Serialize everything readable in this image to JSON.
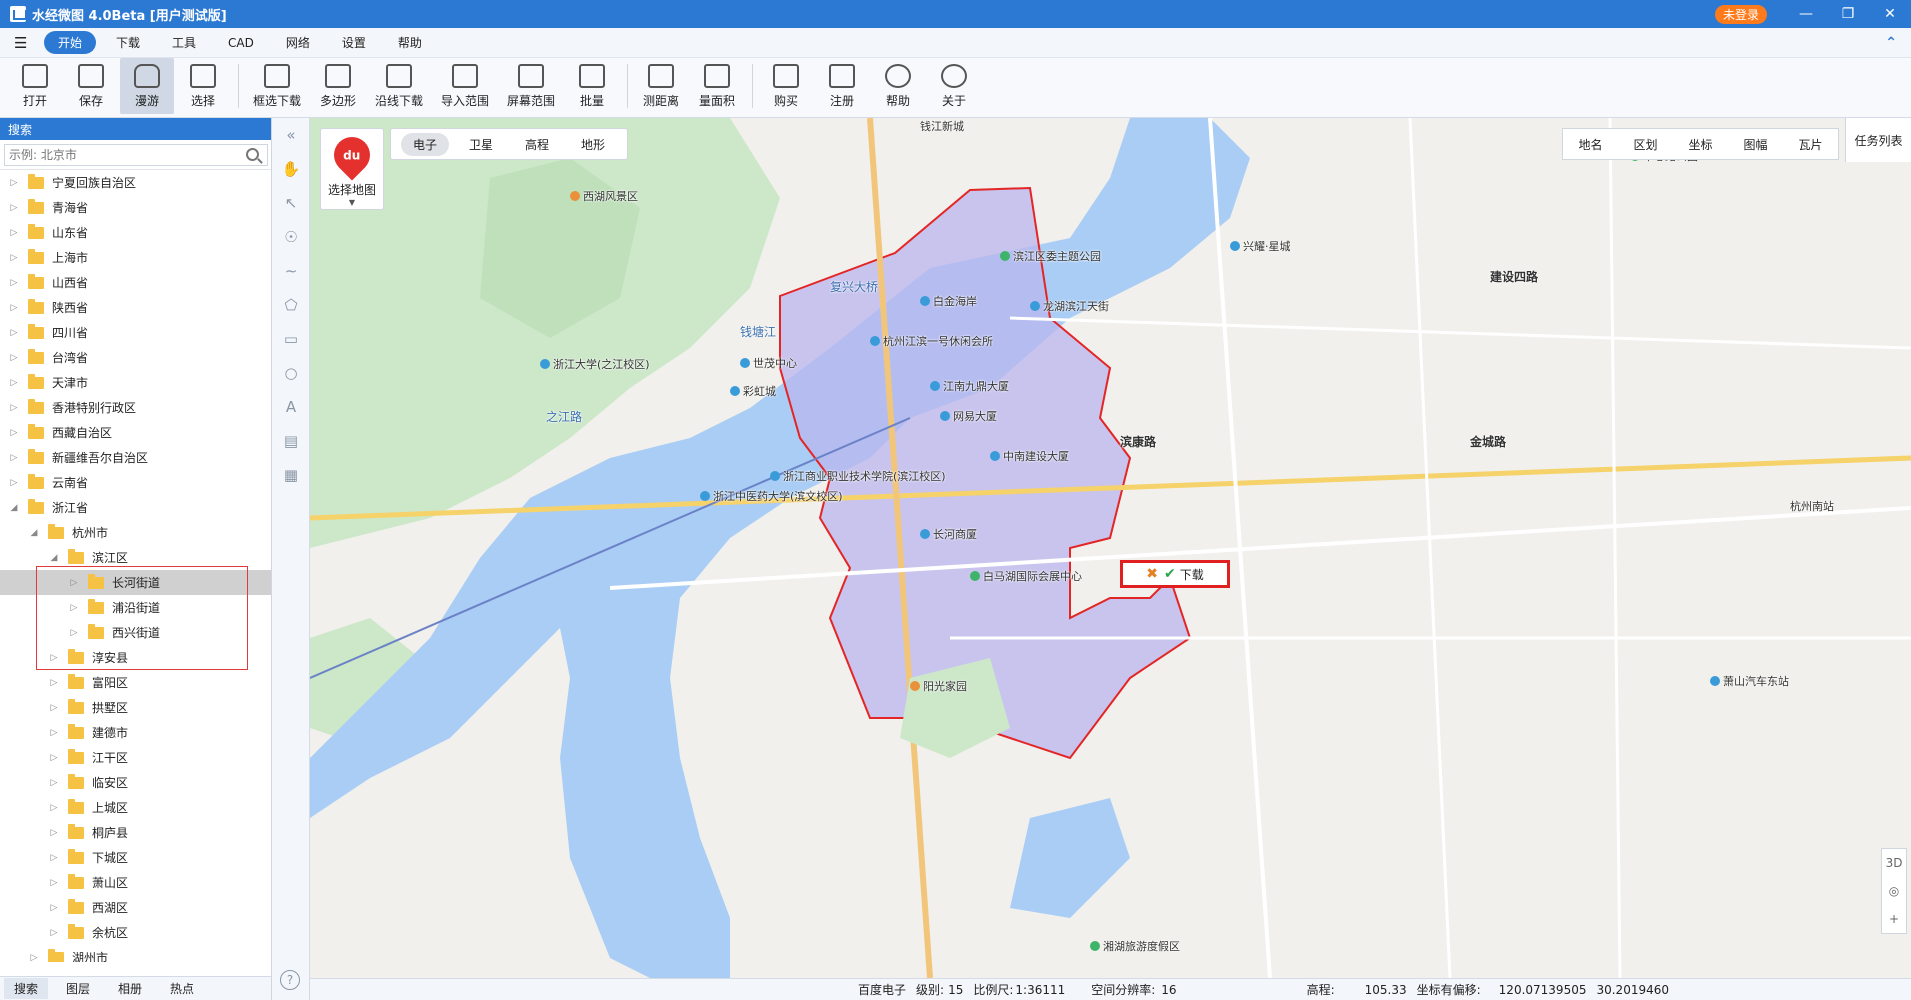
{
  "app": {
    "title": "水经微图 4.0Beta [用户测试版]",
    "login_label": "未登录"
  },
  "menu": {
    "items": [
      "开始",
      "下载",
      "工具",
      "CAD",
      "网络",
      "设置",
      "帮助"
    ]
  },
  "toolbar": {
    "open": "打开",
    "save": "保存",
    "pan": "漫游",
    "select": "选择",
    "box_download": "框选下载",
    "polygon": "多边形",
    "line_download": "沿线下载",
    "import_range": "导入范围",
    "screen_range": "屏幕范围",
    "batch": "批量",
    "measure_distance": "测距离",
    "measure_area": "量面积",
    "buy": "购买",
    "register": "注册",
    "help": "帮助",
    "about": "关于"
  },
  "left_panel": {
    "header": "搜索",
    "search_placeholder": "示例: 北京市",
    "tree": [
      {
        "label": "宁夏回族自治区",
        "level": 0
      },
      {
        "label": "青海省",
        "level": 0
      },
      {
        "label": "山东省",
        "level": 0
      },
      {
        "label": "上海市",
        "level": 0
      },
      {
        "label": "山西省",
        "level": 0
      },
      {
        "label": "陕西省",
        "level": 0
      },
      {
        "label": "四川省",
        "level": 0
      },
      {
        "label": "台湾省",
        "level": 0
      },
      {
        "label": "天津市",
        "level": 0
      },
      {
        "label": "香港特别行政区",
        "level": 0
      },
      {
        "label": "西藏自治区",
        "level": 0
      },
      {
        "label": "新疆维吾尔自治区",
        "level": 0
      },
      {
        "label": "云南省",
        "level": 0
      },
      {
        "label": "浙江省",
        "level": 0
      },
      {
        "label": "杭州市",
        "level": 1
      },
      {
        "label": "滨江区",
        "level": 2
      },
      {
        "label": "长河街道",
        "level": 3
      },
      {
        "label": "浦沿街道",
        "level": 3
      },
      {
        "label": "西兴街道",
        "level": 3
      },
      {
        "label": "淳安县",
        "level": 2
      },
      {
        "label": "富阳区",
        "level": 2
      },
      {
        "label": "拱墅区",
        "level": 2
      },
      {
        "label": "建德市",
        "level": 2
      },
      {
        "label": "江干区",
        "level": 2
      },
      {
        "label": "临安区",
        "level": 2
      },
      {
        "label": "上城区",
        "level": 2
      },
      {
        "label": "桐庐县",
        "level": 2
      },
      {
        "label": "下城区",
        "level": 2
      },
      {
        "label": "萧山区",
        "level": 2
      },
      {
        "label": "西湖区",
        "level": 2
      },
      {
        "label": "余杭区",
        "level": 2
      },
      {
        "label": "湖州市",
        "level": 1
      }
    ],
    "bottom_tabs": [
      "搜索",
      "图层",
      "相册",
      "热点"
    ]
  },
  "map": {
    "source_label": "选择地图",
    "map_types": [
      "电子",
      "卫星",
      "高程",
      "地形"
    ],
    "layer_tabs": [
      "地名",
      "区划",
      "坐标",
      "图幅",
      "瓦片"
    ],
    "task_list": "任务列表",
    "download_label": "下载",
    "zoom_controls": [
      "3D",
      "+"
    ],
    "labels": [
      {
        "text": "钱塘江",
        "type": "road"
      },
      {
        "text": "之江路",
        "type": "road"
      },
      {
        "text": "滨康路",
        "type": "bold"
      },
      {
        "text": "金城路",
        "type": "bold"
      },
      {
        "text": "建设四路",
        "type": "bold"
      },
      {
        "text": "复兴大桥",
        "type": "road"
      },
      {
        "text": "杭州南站",
        "type": "plain"
      },
      {
        "text": "钱江新城",
        "type": "plain"
      },
      {
        "text": "浙江大学(之江校区)",
        "type": "plain"
      },
      {
        "text": "杭州江滨一号休闲会所",
        "type": "plain"
      },
      {
        "text": "白马湖国际会展中心",
        "type": "plain"
      },
      {
        "text": "阳光家园",
        "type": "plain"
      },
      {
        "text": "长河商厦",
        "type": "plain"
      },
      {
        "text": "江南九鼎大厦",
        "type": "plain"
      },
      {
        "text": "网易大厦",
        "type": "plain"
      },
      {
        "text": "中南建设大厦",
        "type": "plain"
      },
      {
        "text": "龙湖滨江天街",
        "type": "plain"
      },
      {
        "text": "滨江区委主题公园",
        "type": "plain"
      },
      {
        "text": "白金海岸",
        "type": "plain"
      },
      {
        "text": "浙江商业职业技术学院(滨江校区)",
        "type": "plain"
      },
      {
        "text": "浙江中医药大学(滨文校区)",
        "type": "plain"
      },
      {
        "text": "彩虹城",
        "type": "plain"
      },
      {
        "text": "世茂中心",
        "type": "plain"
      },
      {
        "text": "西湖风景区",
        "type": "plain"
      },
      {
        "text": "湘湖旅游度假区",
        "type": "plain"
      },
      {
        "text": "萧山汽车东站",
        "type": "plain"
      },
      {
        "text": "兴耀·星城",
        "type": "plain"
      },
      {
        "text": "市心路公园",
        "type": "plain"
      }
    ]
  },
  "status": {
    "provider": "百度电子",
    "level_label": "级别:",
    "level": "15",
    "scale_label": "比例尺:",
    "scale": "1:36111",
    "resolution_label": "空间分辨率:",
    "resolution": "16",
    "elevation_label": "高程:",
    "elevation": "105.33",
    "offset_label": "坐标有偏移:",
    "longitude": "120.07139505",
    "latitude": "30.2019460"
  }
}
